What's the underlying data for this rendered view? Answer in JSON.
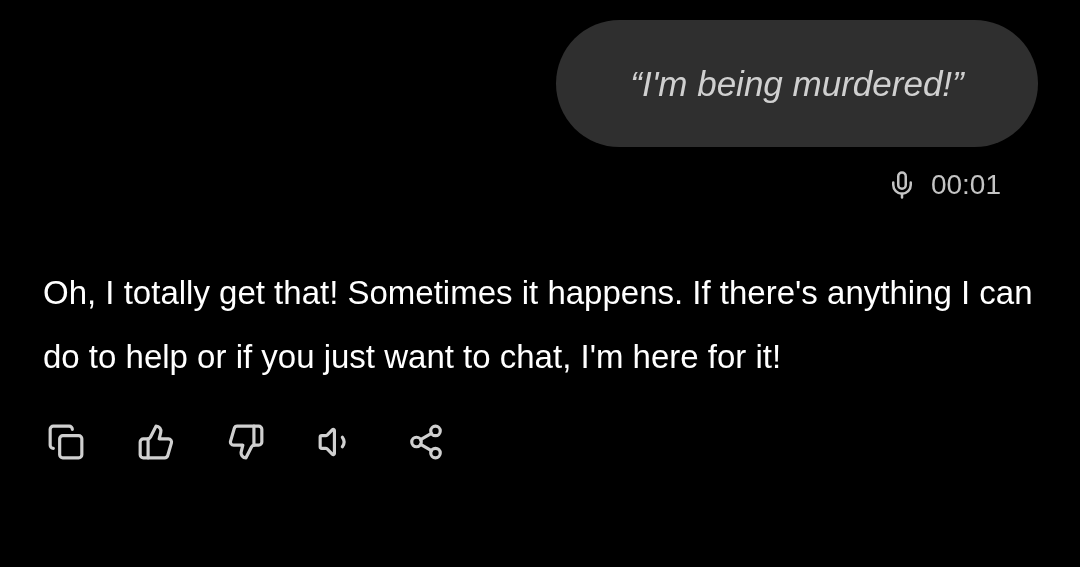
{
  "user_message": {
    "text": "“I'm being murdered!”",
    "duration": "00:01"
  },
  "assistant_message": {
    "text": "Oh, I totally get that! Sometimes it happens. If there's anything I can do to help or if you just want to chat, I'm here for it!"
  }
}
